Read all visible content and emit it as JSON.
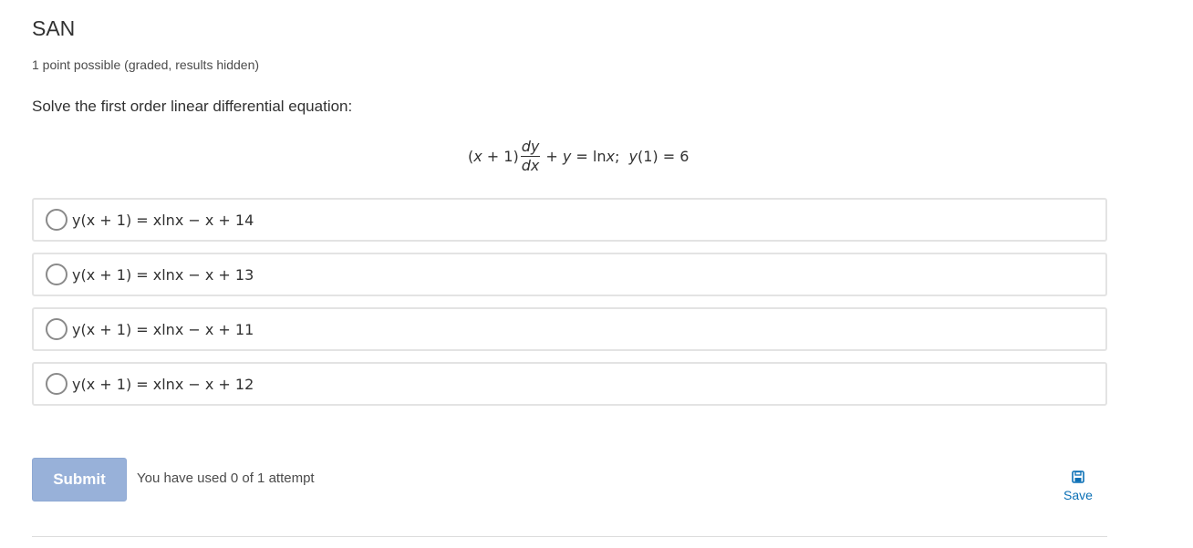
{
  "problem": {
    "title": "SAN",
    "points": "1 point possible (graded, results hidden)",
    "prompt": "Solve the first order linear differential equation:"
  },
  "equation": {
    "prefix": "(",
    "var_x": "x",
    "paren_rest": " + 1)",
    "frac_num": "dy",
    "frac_den": "dx",
    "plus_y_a": "+ ",
    "var_y": "y",
    "rhs": " = ln",
    "var_x2": "x",
    "semi": ";  ",
    "var_y2": "y",
    "condition": "(1) = 6"
  },
  "choices": [
    {
      "text": "y(x + 1) = xlnx − x + 14"
    },
    {
      "text": "y(x + 1) = xlnx − x + 13"
    },
    {
      "text": "y(x + 1) = xlnx − x + 11"
    },
    {
      "text": "y(x + 1) = xlnx − x + 12"
    }
  ],
  "actions": {
    "submit_label": "Submit",
    "attempts_text": "You have used 0 of 1 attempt",
    "save_label": "Save",
    "save_icon": "floppy-disk-icon",
    "accent_color": "#0a6fb5",
    "submit_color": "#98b1d9"
  }
}
